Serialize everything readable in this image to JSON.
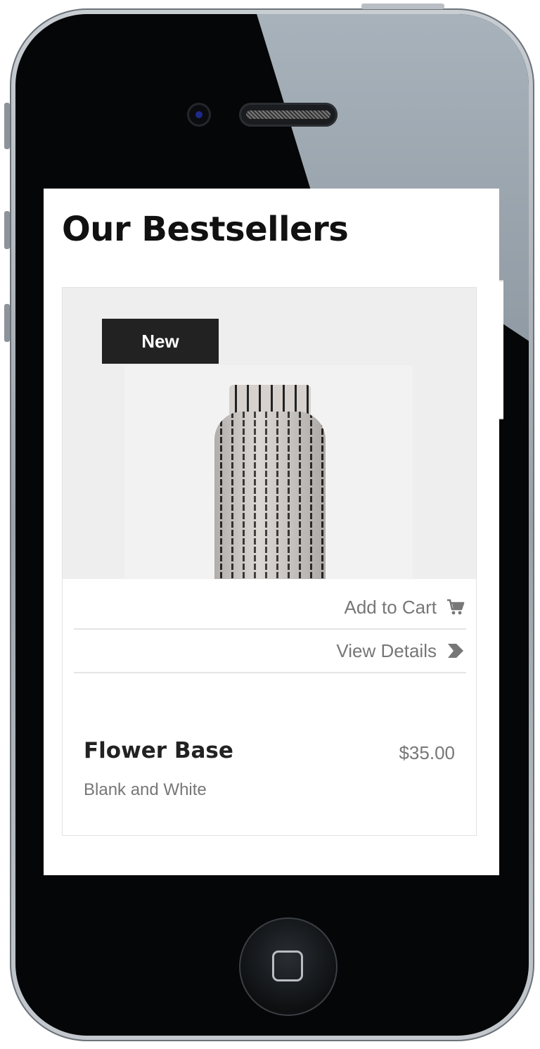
{
  "page": {
    "title": "Our Bestsellers"
  },
  "product": {
    "badge": "New",
    "name": "Flower Base",
    "variant": "Blank and White",
    "price": "$35.00",
    "image_icon": "vase-image"
  },
  "actions": {
    "add_to_cart_label": "Add to Cart",
    "add_to_cart_icon": "cart-icon",
    "view_details_label": "View Details",
    "view_details_icon": "chevron-right-icon"
  },
  "colors": {
    "badge_bg": "#222222",
    "text_primary": "#111111",
    "text_muted": "#777777",
    "divider": "#e5e5e5",
    "image_bg": "#eeeeee"
  }
}
